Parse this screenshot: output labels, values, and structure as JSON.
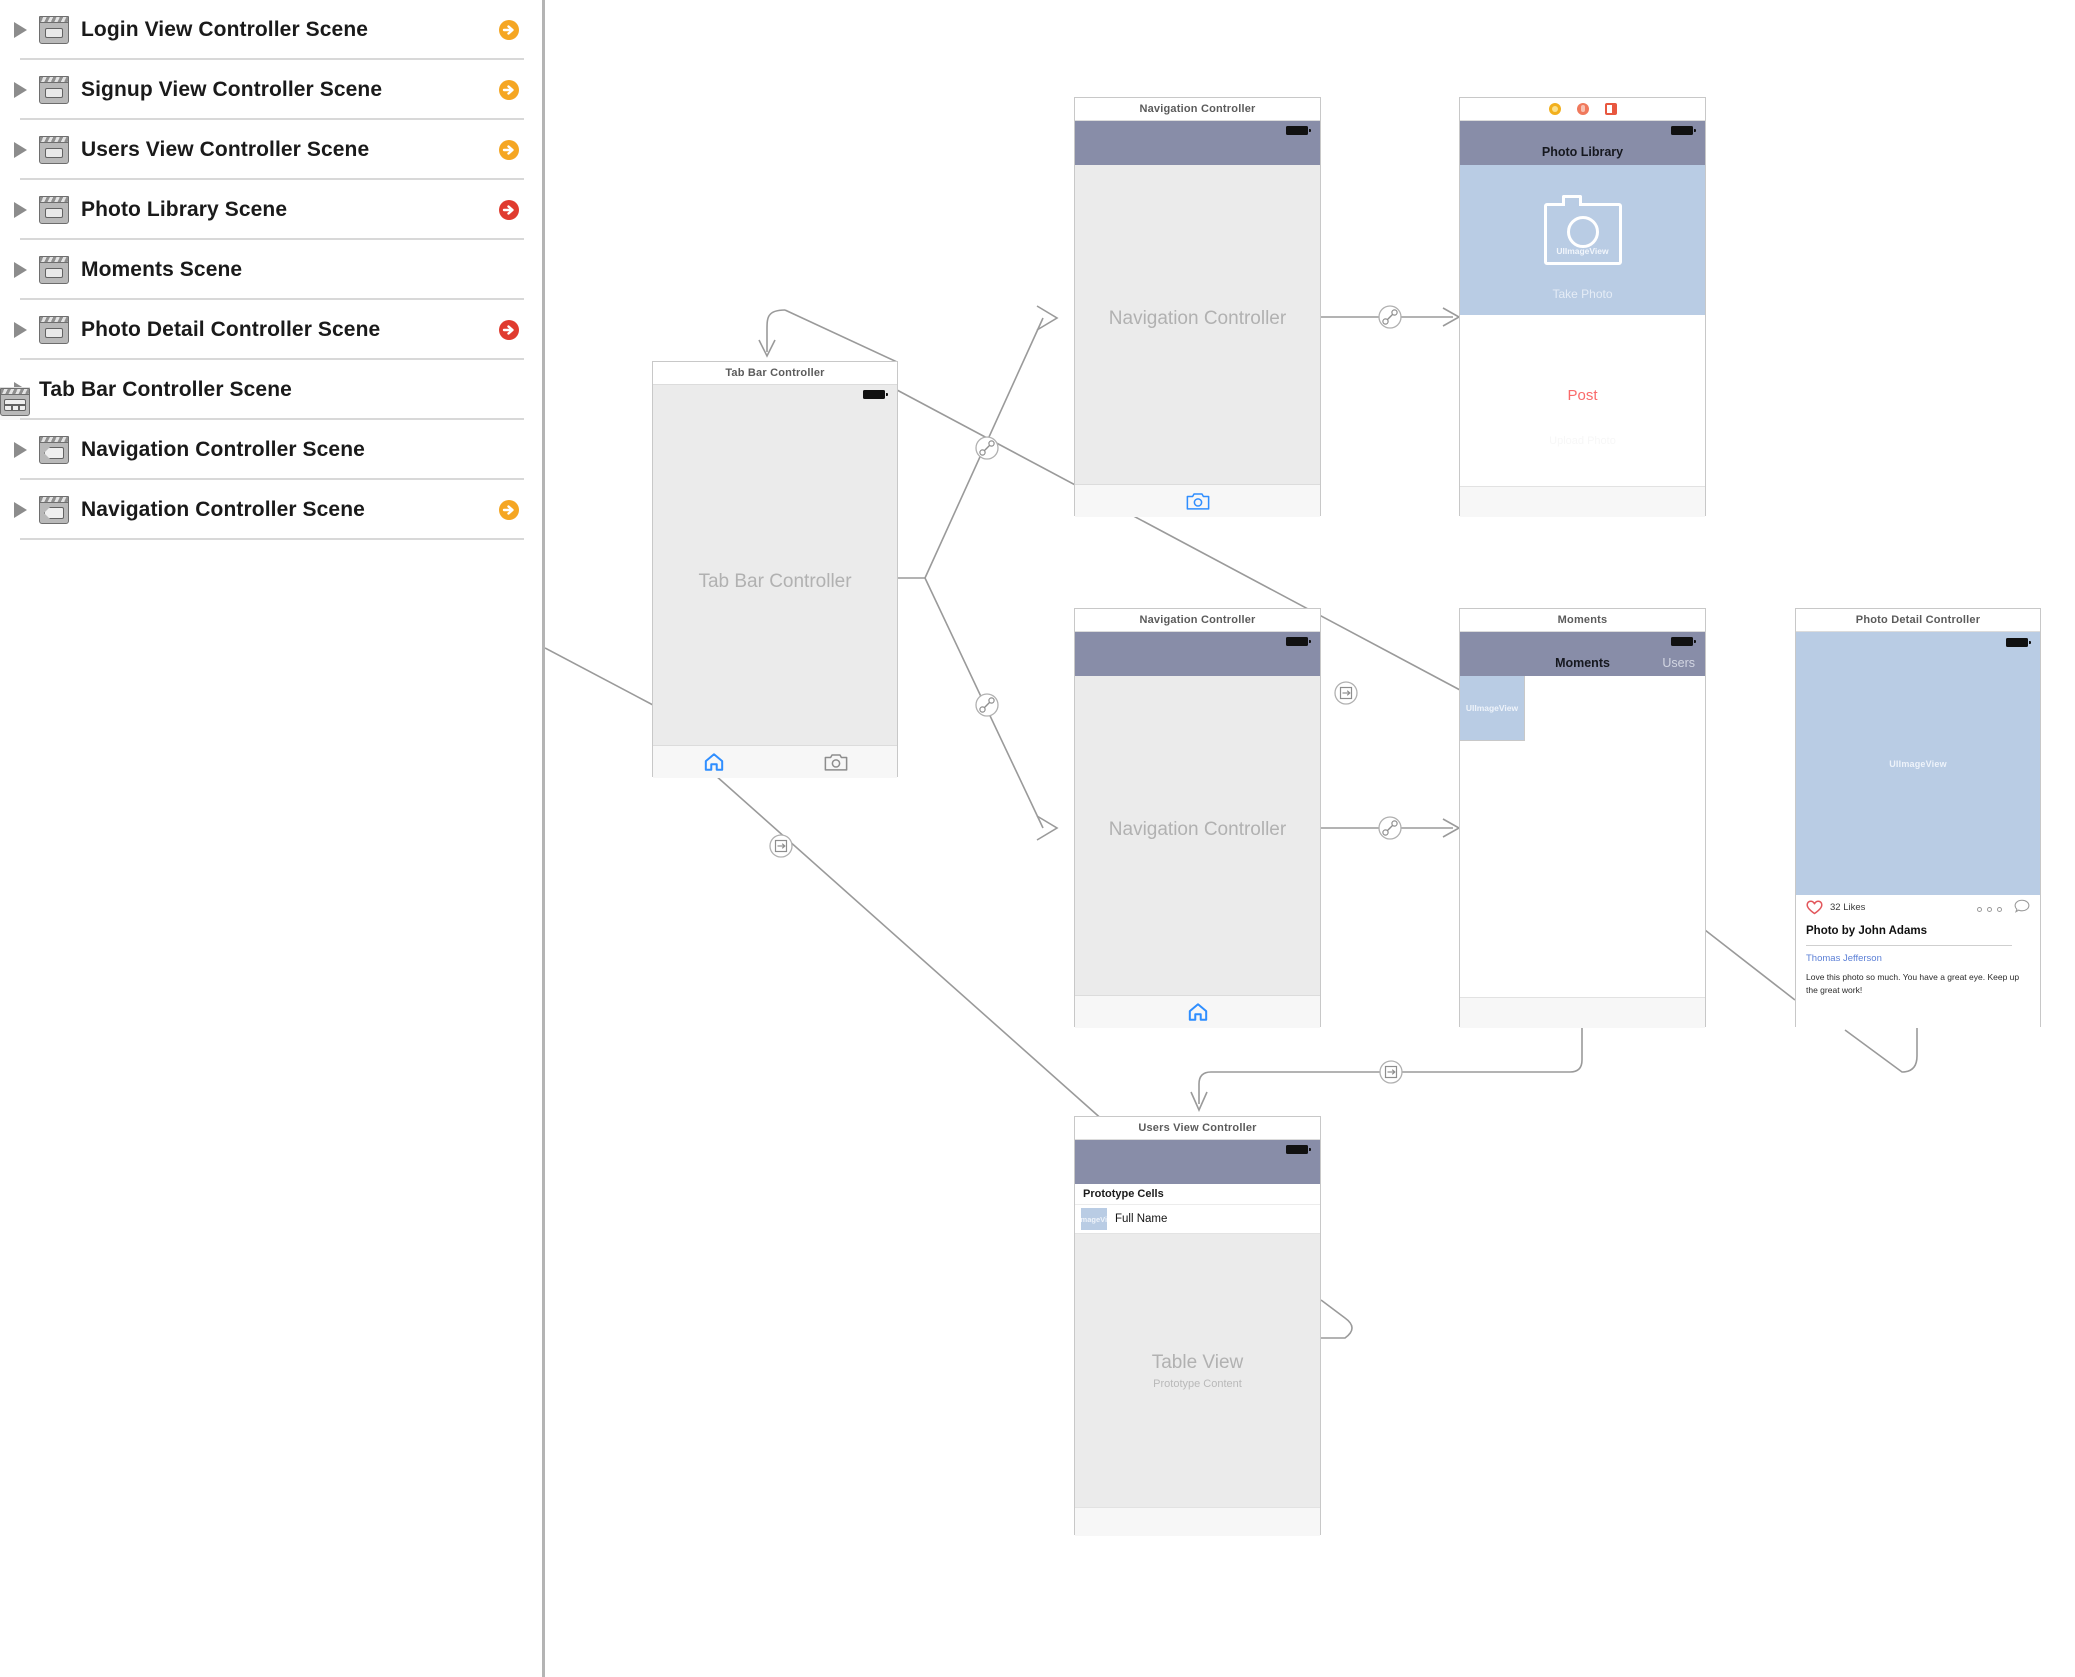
{
  "sidebar": {
    "scenes": [
      {
        "label": "Login View Controller Scene",
        "icon": "view-controller-icon",
        "badge": "orange-arrow"
      },
      {
        "label": "Signup View Controller Scene",
        "icon": "view-controller-icon",
        "badge": "orange-arrow"
      },
      {
        "label": "Users View Controller Scene",
        "icon": "view-controller-icon",
        "badge": "orange-arrow"
      },
      {
        "label": "Photo Library Scene",
        "icon": "view-controller-icon",
        "badge": "red-arrow"
      },
      {
        "label": "Moments Scene",
        "icon": "view-controller-icon",
        "badge": "none"
      },
      {
        "label": "Photo Detail Controller Scene",
        "icon": "view-controller-icon",
        "badge": "red-arrow"
      },
      {
        "label": "Tab Bar Controller Scene",
        "icon": "tab-bar-controller-icon",
        "badge": "none"
      },
      {
        "label": "Navigation Controller Scene",
        "icon": "navigation-controller-icon",
        "badge": "none"
      },
      {
        "label": "Navigation Controller Scene",
        "icon": "navigation-controller-icon",
        "badge": "orange-arrow"
      }
    ]
  },
  "colors": {
    "navbar": "#888da8",
    "image_view": "#b9cce4",
    "placeholder_text": "#b1b1b1",
    "accent_blue": "#2f8eff",
    "post_red": "#fa6b6b",
    "link_blue": "#5b7fd6",
    "badge_orange": "#f5a623",
    "badge_red": "#e03b2f",
    "wire": "#9a9a9a"
  },
  "canvas": {
    "scenes": {
      "tab_bar_controller": {
        "title": "Tab Bar Controller",
        "placeholder": "Tab Bar Controller",
        "tabs": [
          {
            "icon": "home-icon",
            "selected": true
          },
          {
            "icon": "camera-icon",
            "selected": false
          }
        ]
      },
      "navigation_controller_top": {
        "title": "Navigation Controller",
        "placeholder": "Navigation Controller",
        "tabs": [
          {
            "icon": "camera-icon",
            "selected": true
          }
        ]
      },
      "navigation_controller_mid": {
        "title": "Navigation Controller",
        "placeholder": "Navigation Controller",
        "tabs": [
          {
            "icon": "home-icon",
            "selected": true
          }
        ]
      },
      "photo_library": {
        "title": "Photo Library",
        "nav_title": "Photo Library",
        "image_view_label": "UIImageView",
        "take_photo_label": "Take Photo",
        "post_label": "Post",
        "upload_label": "Upload Photo",
        "dock_icons": [
          "view-controller-dock-icon",
          "first-responder-dock-icon",
          "exit-dock-icon"
        ]
      },
      "moments": {
        "title": "Moments",
        "nav_title": "Moments",
        "nav_right_label": "Users",
        "image_view_label": "UIImageView"
      },
      "photo_detail": {
        "title": "Photo Detail Controller",
        "image_view_label": "UIImageView",
        "likes_label": "32 Likes",
        "caption": "Photo by John Adams",
        "commenter": "Thomas Jefferson",
        "comment": "Love this photo so much. You have a great eye. Keep up the great work!"
      },
      "users_view_controller": {
        "title": "Users View Controller",
        "prototype_cells_header": "Prototype Cells",
        "cell_thumb_label": "UIImageView",
        "cell_title": "Full Name",
        "table_view_label": "Table View",
        "table_view_sub": "Prototype Content"
      }
    },
    "segues": [
      {
        "name": "relationship-segue",
        "icon": "relationship-icon"
      },
      {
        "name": "relationship-segue",
        "icon": "relationship-icon"
      },
      {
        "name": "relationship-segue",
        "icon": "relationship-icon"
      },
      {
        "name": "relationship-segue",
        "icon": "relationship-icon"
      },
      {
        "name": "show-segue",
        "icon": "show-segue-icon"
      },
      {
        "name": "show-segue",
        "icon": "show-segue-icon"
      },
      {
        "name": "show-segue",
        "icon": "show-segue-icon"
      }
    ]
  }
}
